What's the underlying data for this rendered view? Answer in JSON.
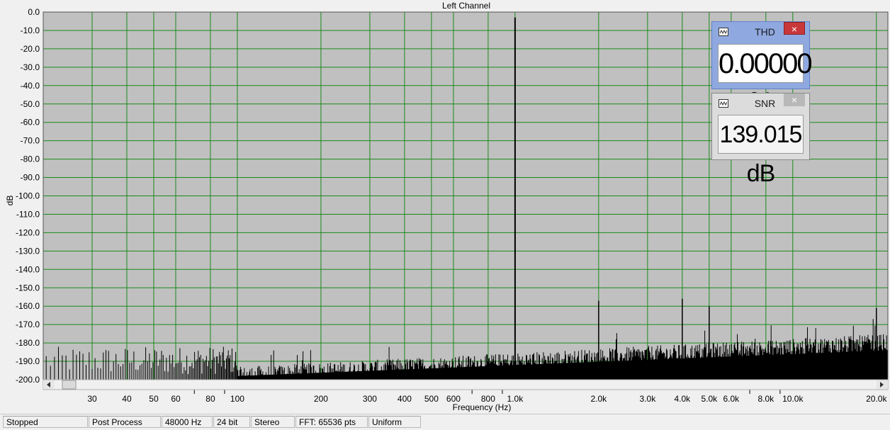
{
  "chart_data": {
    "type": "line",
    "title": "Left Channel",
    "xlabel": "Frequency (Hz)",
    "ylabel": "dB",
    "xscale": "log",
    "xlim": [
      20,
      22000
    ],
    "ylim": [
      -200,
      0
    ],
    "grid": true,
    "x_ticks": [
      30,
      40,
      50,
      60,
      80,
      100,
      200,
      300,
      400,
      500,
      600,
      800,
      1000,
      2000,
      3000,
      4000,
      5000,
      6000,
      8000,
      10000,
      20000
    ],
    "x_tick_labels": [
      "30",
      "40",
      "50",
      "60",
      "80",
      "100",
      "200",
      "300",
      "400",
      "500",
      "600",
      "800",
      "1.0k",
      "2.0k",
      "3.0k",
      "4.0k",
      "5.0k",
      "6.0k",
      "8.0k",
      "10.0k",
      "20.0k"
    ],
    "y_ticks": [
      0,
      -10,
      -20,
      -30,
      -40,
      -50,
      -60,
      -70,
      -80,
      -90,
      -100,
      -110,
      -120,
      -130,
      -140,
      -150,
      -160,
      -170,
      -180,
      -190,
      -200
    ],
    "y_tick_labels": [
      "0.0",
      "-10.0",
      "-20.0",
      "-30.0",
      "-40.0",
      "-50.0",
      "-60.0",
      "-70.0",
      "-80.0",
      "-90.0",
      "-100.0",
      "-110.0",
      "-120.0",
      "-130.0",
      "-140.0",
      "-150.0",
      "-160.0",
      "-170.0",
      "-180.0",
      "-190.0",
      "-200.0"
    ],
    "series": [
      {
        "x": [
          1000,
          2000,
          4000,
          5000,
          20000
        ],
        "y": [
          -3,
          -157,
          -156,
          -160,
          -161
        ]
      }
    ],
    "noise_floor_db": [
      -188,
      -182
    ]
  },
  "meters": {
    "thd": {
      "title": "THD",
      "value": "0.00000 %",
      "close": "×"
    },
    "snr": {
      "title": "SNR",
      "value": "139.015 dB",
      "close": "×"
    }
  },
  "status": [
    "Stopped",
    "Post Process",
    "48000 Hz",
    "24 bit",
    "Stereo",
    "FFT: 65536 pts",
    "Uniform"
  ],
  "colors": {
    "plot_bg": "#c0c0c0",
    "grid": "#1a8a1a",
    "trace": "#000000"
  }
}
